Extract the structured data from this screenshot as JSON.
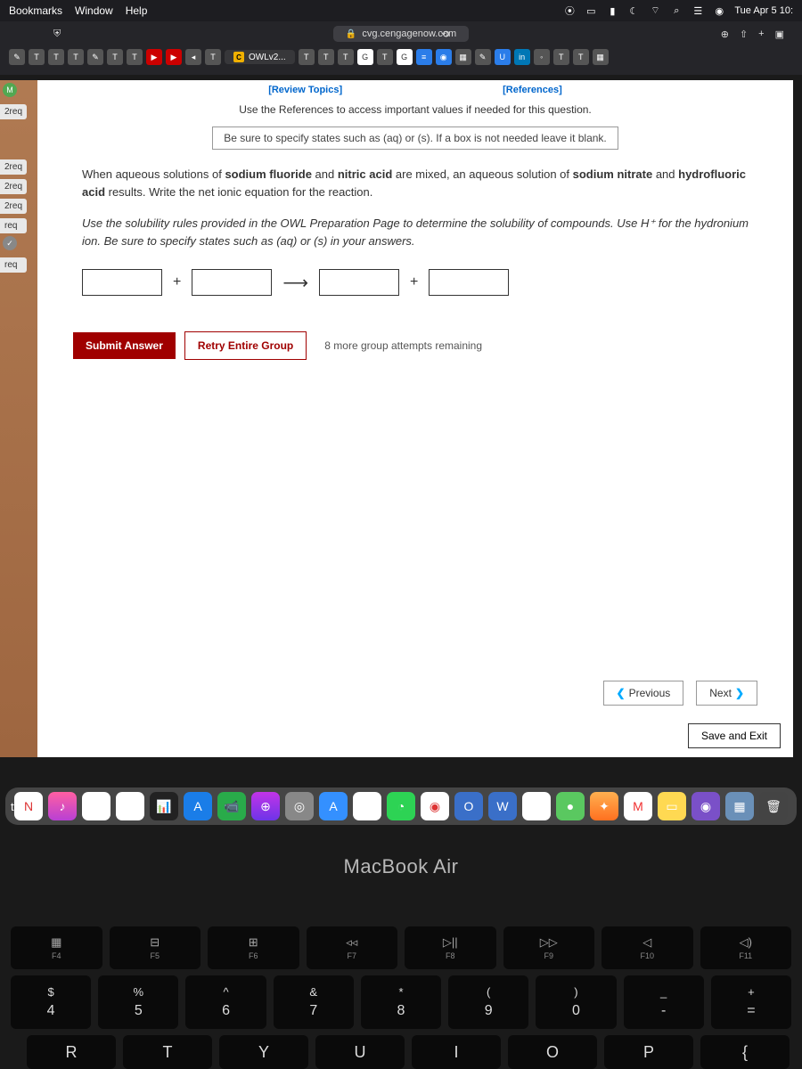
{
  "menubar": {
    "items": [
      "Bookmarks",
      "Window",
      "Help"
    ],
    "datetime": "Tue Apr 5 10:"
  },
  "browser": {
    "url": "cvg.cengagenow.com",
    "tab_label": "OWLv2..."
  },
  "sidebar": {
    "tabs": [
      "2req",
      "2req",
      "2req",
      "2req",
      "req",
      "req"
    ]
  },
  "page": {
    "link_review": "[Review Topics]",
    "link_references": "[References]",
    "instruction": "Use the References to access important values if needed for this question.",
    "hint_box": "Be sure to specify states such as (aq) or (s).  If a box is not needed leave it blank.",
    "question_html": "When aqueous solutions of <b>sodium fluoride</b> and <b>nitric acid</b> are mixed, an aqueous solution of <b>sodium nitrate</b> and <b>hydrofluoric acid</b> results. Write the net ionic equation for the reaction.",
    "italic_hint": "Use the solubility rules provided in the OWL Preparation Page to determine the solubility of compounds. Use H⁺ for the hydronium ion. Be sure to specify states such as (aq) or (s) in your answers.",
    "eq_plus": "+",
    "eq_arrow": "⟶",
    "submit": "Submit Answer",
    "retry": "Retry Entire Group",
    "attempts": "8 more group attempts remaining",
    "prev": "Previous",
    "next": "Next",
    "save_exit": "Save and Exit"
  },
  "hardware": {
    "label": "MacBook Air",
    "fn_keys": [
      {
        "sym": "▦",
        "label": "F4"
      },
      {
        "sym": "⊟",
        "label": "F5"
      },
      {
        "sym": "⊞",
        "label": "F6"
      },
      {
        "sym": "◃◃",
        "label": "F7"
      },
      {
        "sym": "▷||",
        "label": "F8"
      },
      {
        "sym": "▷▷",
        "label": "F9"
      },
      {
        "sym": "◁",
        "label": "F10"
      },
      {
        "sym": "◁)",
        "label": "F11"
      }
    ],
    "num_keys": [
      {
        "upper": "$",
        "lower": "4"
      },
      {
        "upper": "%",
        "lower": "5"
      },
      {
        "upper": "^",
        "lower": "6"
      },
      {
        "upper": "&",
        "lower": "7"
      },
      {
        "upper": "*",
        "lower": "8"
      },
      {
        "upper": "(",
        "lower": "9"
      },
      {
        "upper": ")",
        "lower": "0"
      },
      {
        "upper": "_",
        "lower": "-"
      },
      {
        "upper": "+",
        "lower": "="
      }
    ],
    "letter_keys": [
      "R",
      "T",
      "Y",
      "U",
      "I",
      "O",
      "P",
      "{"
    ]
  }
}
